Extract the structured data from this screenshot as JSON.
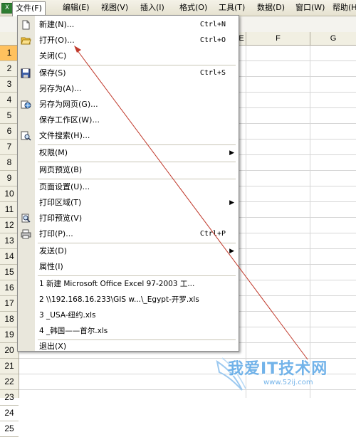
{
  "menubar": {
    "items": [
      {
        "label": "文件(F)"
      },
      {
        "label": "编辑(E)"
      },
      {
        "label": "视图(V)"
      },
      {
        "label": "插入(I)"
      },
      {
        "label": "格式(O)"
      },
      {
        "label": "工具(T)"
      },
      {
        "label": "数据(D)"
      },
      {
        "label": "窗口(W)"
      },
      {
        "label": "帮助(H)"
      }
    ]
  },
  "sheet": {
    "columns": [
      "E",
      "F",
      "G"
    ],
    "rows": [
      "1",
      "2",
      "3",
      "4",
      "5",
      "6",
      "7",
      "8",
      "9",
      "10",
      "11",
      "12",
      "13",
      "14",
      "15",
      "16",
      "17",
      "18",
      "19",
      "20",
      "21",
      "22",
      "23",
      "24",
      "25"
    ],
    "selected_row": "1"
  },
  "file_menu": {
    "items": [
      {
        "label": "新建(N)...",
        "shortcut": "Ctrl+N",
        "icon": "new-document-icon"
      },
      {
        "label": "打开(O)...",
        "shortcut": "Ctrl+O",
        "icon": "open-folder-icon"
      },
      {
        "label": "关闭(C)",
        "shortcut": ""
      },
      {
        "label": "保存(S)",
        "shortcut": "Ctrl+S",
        "icon": "save-icon"
      },
      {
        "label": "另存为(A)...",
        "shortcut": ""
      },
      {
        "label": "另存为网页(G)...",
        "shortcut": "",
        "icon": "save-web-icon"
      },
      {
        "label": "保存工作区(W)...",
        "shortcut": ""
      },
      {
        "label": "文件搜索(H)...",
        "shortcut": "",
        "icon": "file-search-icon"
      },
      {
        "label": "权限(M)",
        "shortcut": "",
        "submenu": true
      },
      {
        "label": "网页预览(B)",
        "shortcut": ""
      },
      {
        "label": "页面设置(U)...",
        "shortcut": ""
      },
      {
        "label": "打印区域(T)",
        "shortcut": "",
        "submenu": true
      },
      {
        "label": "打印预览(V)",
        "shortcut": "",
        "icon": "print-preview-icon"
      },
      {
        "label": "打印(P)...",
        "shortcut": "Ctrl+P",
        "icon": "print-icon"
      },
      {
        "label": "发送(D)",
        "shortcut": "",
        "submenu": true
      },
      {
        "label": "属性(I)",
        "shortcut": ""
      },
      {
        "label": "1 新建 Microsoft Office Excel 97-2003 工...",
        "shortcut": ""
      },
      {
        "label": "2 \\\\192.168.16.233\\GIS  w...\\_Egypt-开罗.xls",
        "shortcut": ""
      },
      {
        "label": "3 _USA-纽约.xls",
        "shortcut": ""
      },
      {
        "label": "4 _韩国——首尔.xls",
        "shortcut": ""
      },
      {
        "label": "退出(X)",
        "shortcut": ""
      }
    ]
  },
  "watermark": {
    "text": "我爱IT技术网",
    "url": "www.52ij.com"
  },
  "colors": {
    "annotation_arrow": "#c0392b",
    "selected_row_header": "#ffc15e",
    "menu_gutter": "#e9e7dc"
  }
}
